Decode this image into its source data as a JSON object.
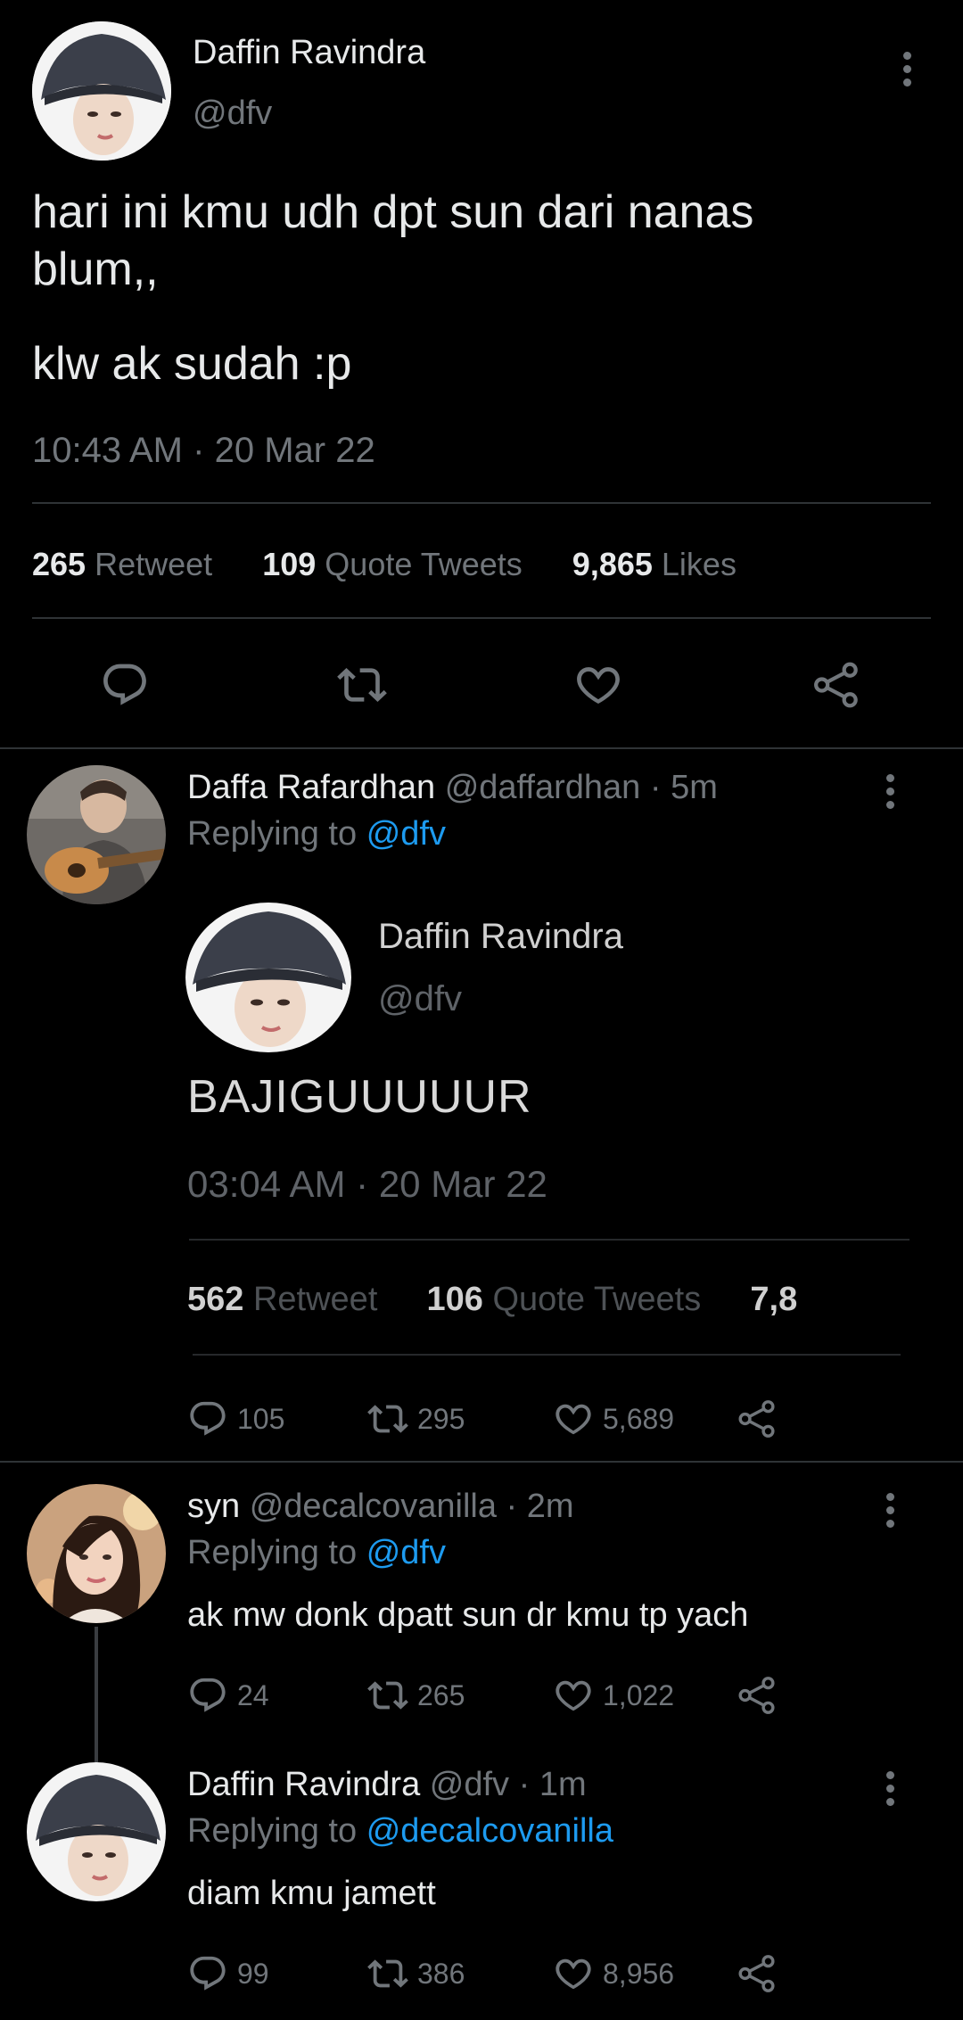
{
  "main_tweet": {
    "author_name": "Daffin Ravindra",
    "author_handle": "@dfv",
    "text_line1": "hari ini kmu udh dpt sun dari nanas",
    "text_line2": "blum,,",
    "text_line3": "klw ak sudah :p",
    "time": "10:43 AM",
    "sep": "·",
    "date": "20 Mar 22",
    "retweets_count": "265",
    "retweets_label": "Retweet",
    "quotes_count": "109",
    "quotes_label": "Quote Tweets",
    "likes_count": "9,865",
    "likes_label": "Likes"
  },
  "replies": [
    {
      "name": "Daffa Rafardhan",
      "handle": "@daffardhan",
      "time_sep": "·",
      "time": "5m",
      "replying_label": "Replying to",
      "replying_to": "@dfv",
      "embedded": {
        "name": "Daffin Ravindra",
        "handle": "@dfv",
        "text": "BAJIGUUUUUR",
        "time": "03:04 AM",
        "sep": "·",
        "date": "20 Mar 22",
        "retweets_count": "562",
        "retweets_label": "Retweet",
        "quotes_count": "106",
        "quotes_label": "Quote Tweets",
        "likes_partial": "7,8"
      },
      "replies_count": "105",
      "retweets": "295",
      "likes": "5,689"
    },
    {
      "name": "syn",
      "handle": "@decalcovanilla",
      "time_sep": "·",
      "time": "2m",
      "replying_label": "Replying to",
      "replying_to": "@dfv",
      "text": "ak mw donk dpatt sun dr kmu tp yach",
      "replies_count": "24",
      "retweets": "265",
      "likes": "1,022"
    },
    {
      "name": "Daffin Ravindra",
      "handle": "@dfv",
      "time_sep": "·",
      "time": "1m",
      "replying_label": "Replying to",
      "replying_to": "@decalcovanilla",
      "text": "diam kmu jamett",
      "replies_count": "99",
      "retweets": "386",
      "likes": "8,956"
    }
  ],
  "colors": {
    "background": "#000000",
    "text": "#e7e9ea",
    "muted": "#71767b",
    "link": "#1d9bf0",
    "divider": "#2f3336"
  }
}
